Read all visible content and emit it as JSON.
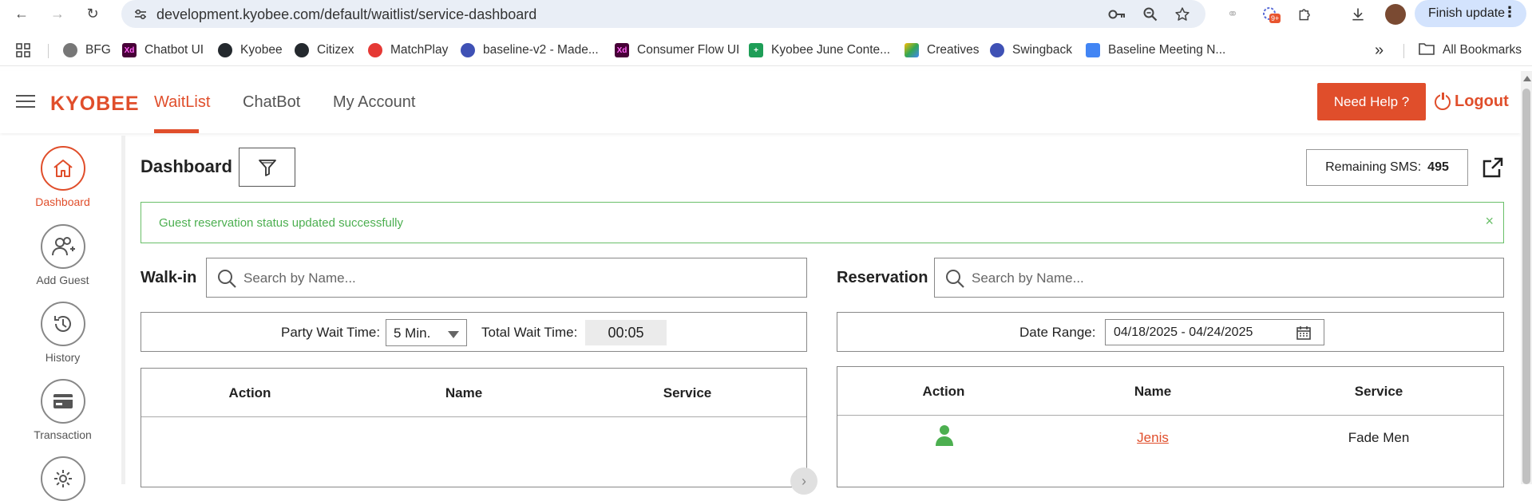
{
  "browser": {
    "url": "development.kyobee.com/default/waitlist/service-dashboard",
    "finish_update_label": "Finish update",
    "extension_badge": "9+",
    "icons": [
      "back-icon",
      "forward-icon",
      "reload-icon",
      "site-info-icon",
      "password-key-icon",
      "zoom-icon",
      "star-icon",
      "extension-icon",
      "puzzle-icon",
      "download-icon",
      "profile-avatar"
    ],
    "bookmarks": [
      {
        "label": "BFG"
      },
      {
        "label": "Chatbot UI"
      },
      {
        "label": "Kyobee"
      },
      {
        "label": "Citizex"
      },
      {
        "label": "MatchPlay"
      },
      {
        "label": "baseline-v2 - Made..."
      },
      {
        "label": "Consumer Flow UI"
      },
      {
        "label": "Kyobee June Conte..."
      },
      {
        "label": "Creatives"
      },
      {
        "label": "Swingback"
      },
      {
        "label": "Baseline Meeting N..."
      }
    ],
    "more_bookmarks": "»",
    "all_bookmarks_label": "All Bookmarks"
  },
  "header": {
    "logo": "KYOBEE",
    "tabs": [
      {
        "label": "WaitList",
        "active": true
      },
      {
        "label": "ChatBot",
        "active": false
      },
      {
        "label": "My Account",
        "active": false
      }
    ],
    "help_label": "Need Help ?",
    "logout_label": "Logout",
    "accent_color": "#e04e2b"
  },
  "sidebar": {
    "items": [
      {
        "label": "Dashboard",
        "icon": "home-icon",
        "active": true
      },
      {
        "label": "Add Guest",
        "icon": "add-user-icon",
        "active": false
      },
      {
        "label": "History",
        "icon": "history-icon",
        "active": false
      },
      {
        "label": "Transaction",
        "icon": "card-icon",
        "active": false
      },
      {
        "label": "",
        "icon": "gear-icon",
        "active": false
      }
    ]
  },
  "dashboard": {
    "title": "Dashboard",
    "sms_label": "Remaining SMS:",
    "sms_value": "495",
    "alert_message": "Guest reservation status updated successfully",
    "alert_close": "×"
  },
  "walkin": {
    "label": "Walk-in",
    "search_placeholder": "Search by Name...",
    "party_wait_label": "Party Wait Time:",
    "party_wait_value": "5 Min.",
    "total_wait_label": "Total Wait Time:",
    "total_wait_value": "00:05",
    "columns": [
      "Action",
      "Name",
      "Service"
    ],
    "rows": []
  },
  "reservation": {
    "label": "Reservation",
    "search_placeholder": "Search by Name...",
    "date_range_label": "Date Range:",
    "date_range_value": "04/18/2025 - 04/24/2025",
    "columns": [
      "Action",
      "Name",
      "Service"
    ],
    "rows": [
      {
        "action_icon": "person-icon",
        "name": "Jenis",
        "service": "Fade Men"
      }
    ]
  }
}
